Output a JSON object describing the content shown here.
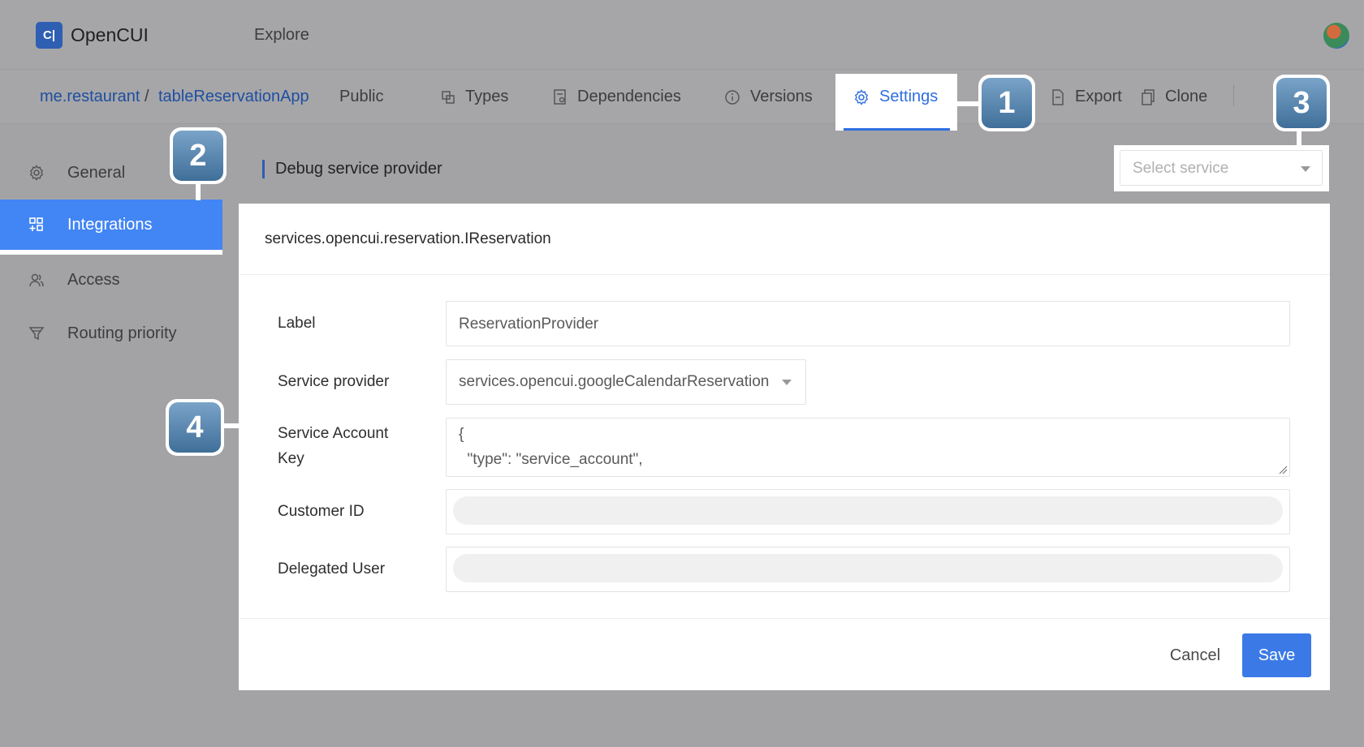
{
  "header": {
    "logo_text": "OpenCUI",
    "logo_mark": "C|",
    "explore": "Explore"
  },
  "breadcrumb": {
    "org": "me.restaurant",
    "separator": "/",
    "project": "tableReservationApp"
  },
  "tabs": {
    "public": "Public",
    "types": "Types",
    "dependencies": "Dependencies",
    "versions": "Versions",
    "settings": "Settings",
    "export": "Export",
    "clone": "Clone"
  },
  "callouts": [
    "1",
    "2",
    "3",
    "4"
  ],
  "sidebar": {
    "items": [
      {
        "label": "General",
        "icon": "gear-icon"
      },
      {
        "label": "Integrations",
        "icon": "grid-plus-icon",
        "active": true
      },
      {
        "label": "Access",
        "icon": "users-icon"
      },
      {
        "label": "Routing priority",
        "icon": "filter-icon"
      }
    ]
  },
  "debug": {
    "label": "Debug service provider",
    "select_placeholder": "Select service"
  },
  "panel": {
    "title": "services.opencui.reservation.IReservation",
    "fields": {
      "label": {
        "label": "Label",
        "value": "ReservationProvider"
      },
      "provider": {
        "label": "Service provider",
        "value": "services.opencui.googleCalendarReservation"
      },
      "key": {
        "label_line1": "Service Account",
        "label_line2": "Key",
        "value": "{\n  \"type\": \"service_account\","
      },
      "customer": {
        "label": "Customer ID",
        "value": ""
      },
      "delegated": {
        "label": "Delegated User",
        "value": ""
      }
    },
    "cancel": "Cancel",
    "save": "Save"
  },
  "colors": {
    "accent": "#4285f4",
    "link": "#1f4fa0",
    "save_button": "#3b7ae6"
  }
}
